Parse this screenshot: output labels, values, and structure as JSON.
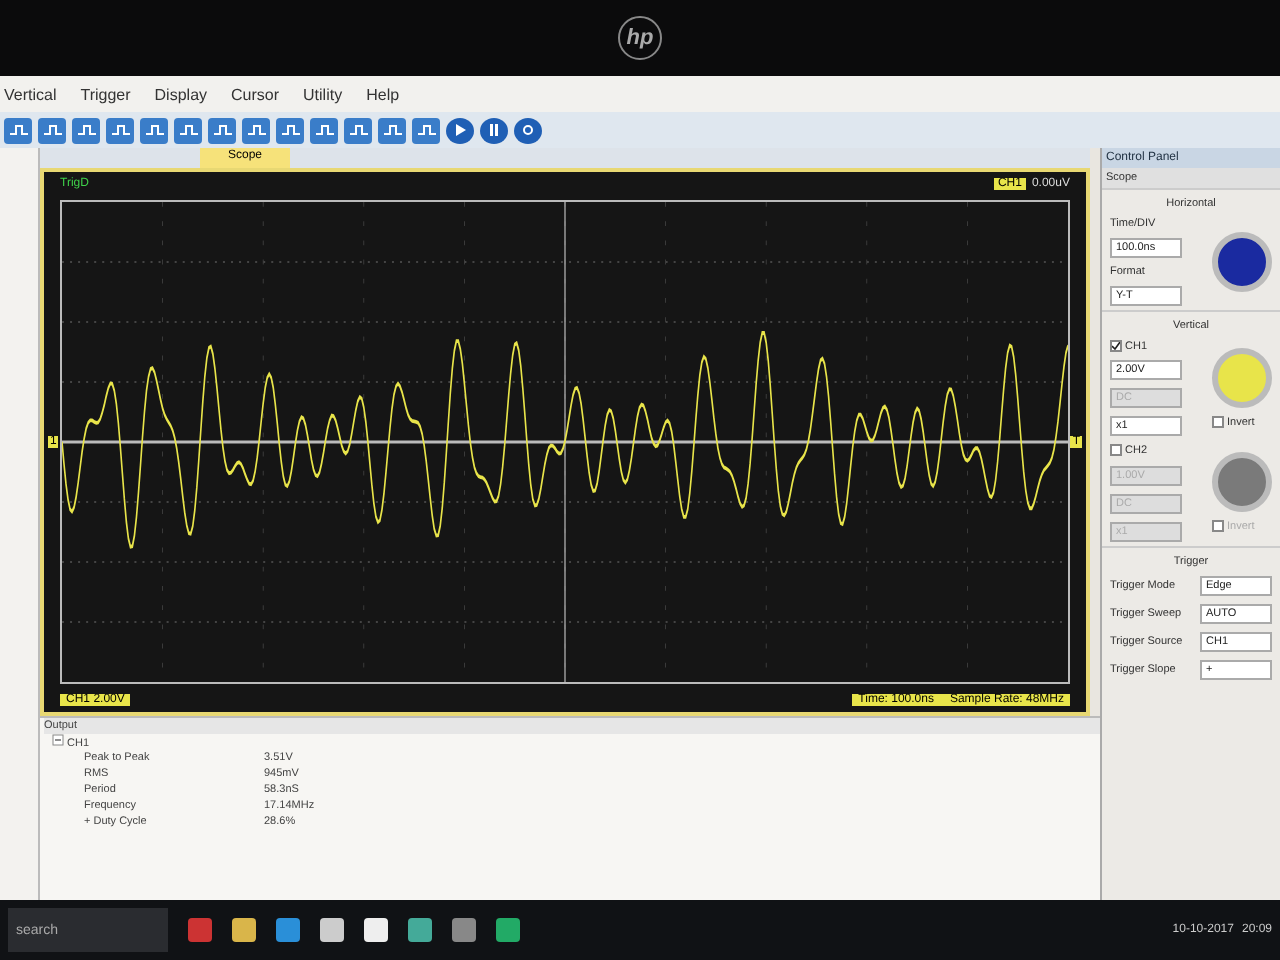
{
  "monitor": {
    "logo": "hp"
  },
  "menu": [
    "Vertical",
    "Trigger",
    "Display",
    "Cursor",
    "Utility",
    "Help"
  ],
  "tab": {
    "label": "Scope",
    "selected": true
  },
  "scope": {
    "title": "TrigD",
    "trigger_readout": "CH1",
    "trigger_level": "0.00uV",
    "channel_marker": "1",
    "trigger_marker": "T",
    "ch_label": "CH1",
    "ch_scale": "2.00V",
    "time": "Time: 100.0ns",
    "sample_rate": "Sample Rate: 48MHz"
  },
  "control_panel": {
    "title": "Control Panel",
    "subtitle": "Scope",
    "horizontal": {
      "heading": "Horizontal",
      "time_label": "Time/DIV",
      "time_value": "100.0ns",
      "format_label": "Format",
      "format_value": "Y-T"
    },
    "vertical": {
      "heading": "Vertical",
      "channels": [
        {
          "name": "CH1",
          "checked": true,
          "scale": "2.00V",
          "coupling": "DC",
          "probe": "x1",
          "invert": "Invert",
          "invert_checked": false,
          "color": "#e8e44a"
        },
        {
          "name": "CH2",
          "checked": false,
          "scale": "1.00V",
          "coupling": "DC",
          "probe": "x1",
          "invert": "Invert",
          "invert_checked": false,
          "color": "#7a7a7a"
        }
      ]
    },
    "trigger": {
      "heading": "Trigger",
      "rows": [
        {
          "label": "Trigger Mode",
          "value": "Edge"
        },
        {
          "label": "Trigger Sweep",
          "value": "AUTO"
        },
        {
          "label": "Trigger Source",
          "value": "CH1"
        },
        {
          "label": "Trigger Slope",
          "value": "+"
        }
      ]
    }
  },
  "output": {
    "title": "Output",
    "channel": "CH1",
    "expanded": true,
    "rows": [
      {
        "label": "Peak to Peak",
        "value": "3.51V"
      },
      {
        "label": "RMS",
        "value": "945mV"
      },
      {
        "label": "Period",
        "value": "58.3nS"
      },
      {
        "label": "Frequency",
        "value": "17.14MHz"
      },
      {
        "label": "+ Duty Cycle",
        "value": "28.6%"
      }
    ]
  },
  "taskbar": {
    "search": "search",
    "date": "10-10-2017",
    "time": "20:09"
  }
}
